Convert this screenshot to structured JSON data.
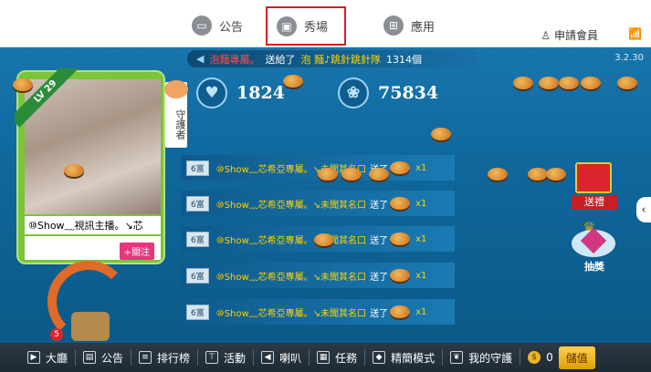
{
  "top_tabs": [
    {
      "label": "公告",
      "icon": "monitor-icon"
    },
    {
      "label": "秀場",
      "icon": "film-icon"
    },
    {
      "label": "應用",
      "icon": "apps-icon"
    }
  ],
  "apply_member": "申請會員",
  "ticker": {
    "name": "泡麵專屬。",
    "action": "送給了",
    "target": "泡 麵♪跳針跳針隊",
    "count": "1314個"
  },
  "version": "3.2.30",
  "host": {
    "level": "LV 29",
    "name": "⑩Show﹏視訊主播。↘芯",
    "follow_label": "+關注"
  },
  "guard_label": "守護者",
  "stats": {
    "hearts": "1824",
    "roses": "75834"
  },
  "chat": {
    "badge": "6富",
    "rows": [
      {
        "text": "⑩Show﹏芯希亞專屬。↘未聞其名口",
        "sent": "送了",
        "qty": "x1"
      },
      {
        "text": "⑩Show﹏芯希亞專屬。↘未聞其名口",
        "sent": "送了",
        "qty": "x1"
      },
      {
        "text": "⑩Show﹏芯希亞專屬。↘未聞其名口",
        "sent": "送了",
        "qty": "x1"
      },
      {
        "text": "⑩Show﹏芯希亞專屬。↘未聞其名口",
        "sent": "送了",
        "qty": "x1"
      },
      {
        "text": "⑩Show﹏芯希亞專屬。↘未聞其名口",
        "sent": "送了",
        "qty": "x1"
      }
    ]
  },
  "gift_button": "送禮",
  "lottery_button": "抽獎",
  "badge_count": "5",
  "bottom": [
    {
      "label": "大廳",
      "icon": "play-icon"
    },
    {
      "label": "公告",
      "icon": "notice-icon"
    },
    {
      "label": "排行榜",
      "icon": "list-icon"
    },
    {
      "label": "活動",
      "icon": "signpost-icon"
    },
    {
      "label": "喇叭",
      "icon": "speaker-icon"
    },
    {
      "label": "任務",
      "icon": "calendar-icon"
    },
    {
      "label": "精簡模式",
      "icon": "cube-icon"
    },
    {
      "label": "我的守護",
      "icon": "leaf-icon"
    }
  ],
  "coins": "0",
  "store_label": "儲值",
  "colors": {
    "stage": "#0f679c",
    "accent_red": "#d61f1f",
    "host_card": "#7cc43b",
    "gold": "#ffd400"
  }
}
